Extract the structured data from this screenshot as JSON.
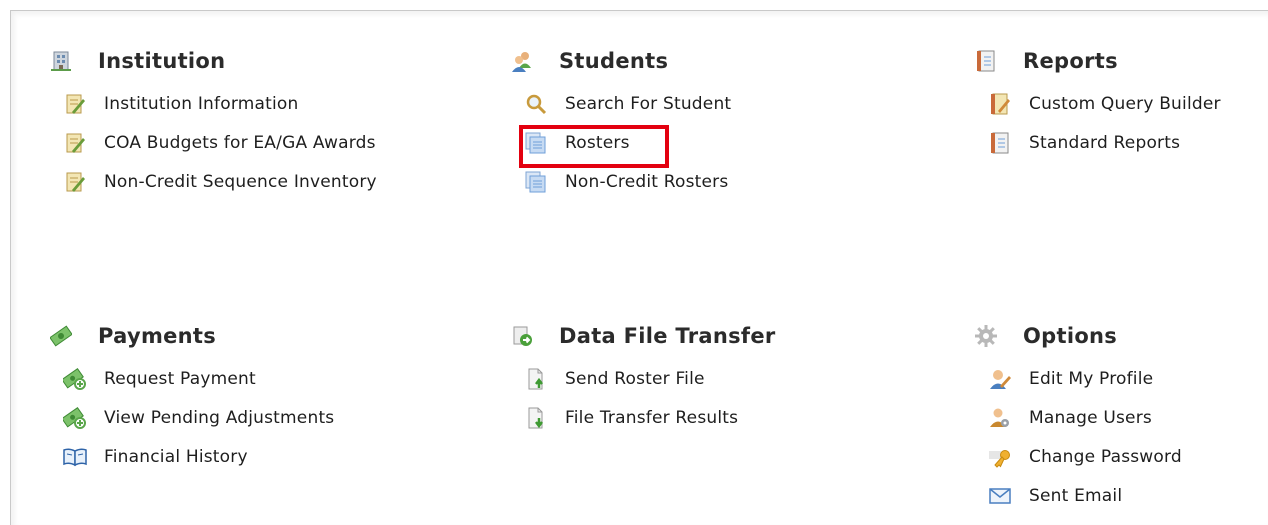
{
  "sections": [
    {
      "title": "Institution",
      "icon": "building-icon",
      "items": [
        {
          "label": "Institution Information",
          "icon": "edit-document-icon"
        },
        {
          "label": "COA Budgets for EA/GA Awards",
          "icon": "edit-document-icon"
        },
        {
          "label": "Non-Credit Sequence Inventory",
          "icon": "edit-document-icon"
        }
      ]
    },
    {
      "title": "Students",
      "icon": "users-icon",
      "items": [
        {
          "label": "Search For Student",
          "icon": "magnifier-icon"
        },
        {
          "label": "Rosters",
          "icon": "roster-document-icon"
        },
        {
          "label": "Non-Credit Rosters",
          "icon": "roster-document-icon"
        }
      ]
    },
    {
      "title": "Reports",
      "icon": "report-icon",
      "items": [
        {
          "label": "Custom Query Builder",
          "icon": "report-edit-icon"
        },
        {
          "label": "Standard Reports",
          "icon": "report-icon"
        }
      ]
    },
    {
      "title": "Payments",
      "icon": "money-icon",
      "items": [
        {
          "label": "Request Payment",
          "icon": "money-add-icon"
        },
        {
          "label": "View Pending Adjustments",
          "icon": "money-add-icon"
        },
        {
          "label": "Financial History",
          "icon": "book-icon"
        }
      ]
    },
    {
      "title": "Data File Transfer",
      "icon": "file-transfer-icon",
      "items": [
        {
          "label": "Send Roster File",
          "icon": "file-upload-icon"
        },
        {
          "label": "File Transfer Results",
          "icon": "file-download-icon"
        }
      ]
    },
    {
      "title": "Options",
      "icon": "gear-icon",
      "items": [
        {
          "label": "Edit My Profile",
          "icon": "user-edit-icon"
        },
        {
          "label": "Manage Users",
          "icon": "users-manage-icon"
        },
        {
          "label": "Change Password",
          "icon": "key-icon"
        },
        {
          "label": "Sent Email",
          "icon": "envelope-icon"
        }
      ]
    }
  ],
  "colors": {
    "highlight": "#e3000f",
    "money_green": "#5aa64a",
    "doc_blue": "#6f9fd8"
  }
}
